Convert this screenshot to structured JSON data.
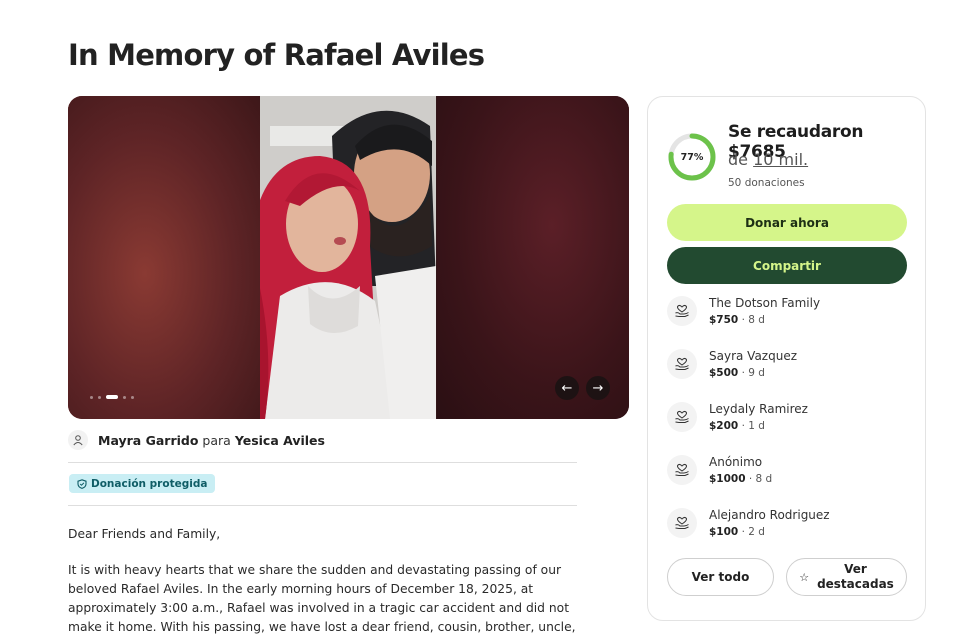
{
  "page": {
    "title": "In Memory of Rafael Aviles"
  },
  "gallery": {
    "slide_count": 5,
    "active_slide": 3
  },
  "organizer": {
    "name": "Mayra Garrido",
    "connector": "para",
    "beneficiary": "Yesica Aviles"
  },
  "badge": {
    "label": "Donación protegida"
  },
  "story": {
    "greeting": "Dear Friends and Family,",
    "paragraph": "It is with heavy hearts that we share the sudden and devastating passing of our beloved Rafael Aviles. In the early morning hours of December 18, 2025, at approximately 3:00 a.m., Rafael was involved in a tragic car accident and did not make it home. With his passing, we have lost a dear friend, cousin, brother, uncle, father, and husband."
  },
  "fundraiser": {
    "percent_label": "77%",
    "progress": 0.77,
    "raised_text": "Se recaudaron $7685",
    "goal_prefix": "de",
    "goal_amount": "10 mil.",
    "donations_count": "50 donaciones",
    "donate_label": "Donar ahora",
    "share_label": "Compartir",
    "accent_color": "#d5f58a",
    "dark_color": "#224a30",
    "ring_color": "#6cc24a"
  },
  "donors": [
    {
      "name": "The Dotson Family",
      "amount": "$750",
      "time": " · 8 d"
    },
    {
      "name": "Sayra Vazquez",
      "amount": "$500",
      "time": " · 9 d"
    },
    {
      "name": "Leydaly Ramirez",
      "amount": "$200",
      "time": " · 1 d"
    },
    {
      "name": "Anónimo",
      "amount": "$1000",
      "time": " · 8 d"
    },
    {
      "name": "Alejandro Rodriguez",
      "amount": "$100",
      "time": " · 2 d"
    }
  ],
  "actions": {
    "see_all": "Ver todo",
    "featured_line1": "Ver",
    "featured_line2": "destacadas"
  }
}
